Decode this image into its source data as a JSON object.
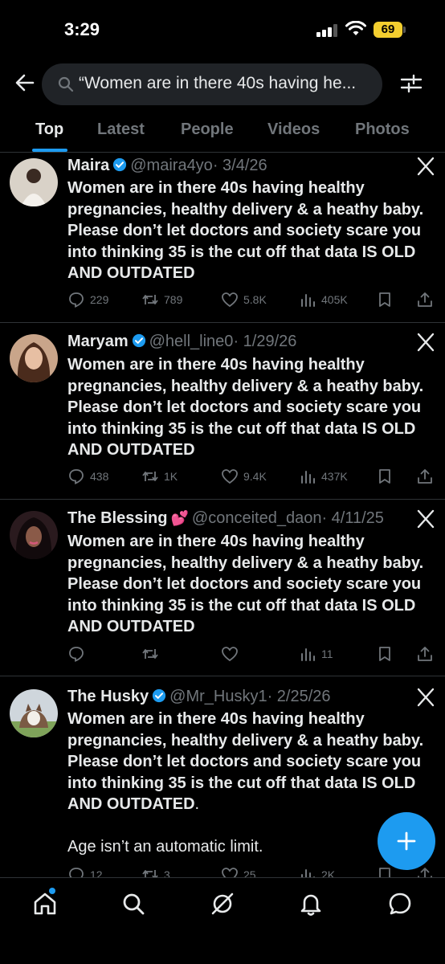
{
  "status_bar": {
    "time": "3:29",
    "battery": "69"
  },
  "search": {
    "query": "“Women are in there 40s having he..."
  },
  "tabs": [
    {
      "label": "Top",
      "active": true
    },
    {
      "label": "Latest"
    },
    {
      "label": "People"
    },
    {
      "label": "Videos"
    },
    {
      "label": "Photos"
    }
  ],
  "posts": [
    {
      "name": "Maira",
      "verified": true,
      "handle": "@maira4yo",
      "date": "· 3/4/26",
      "text": "Women are in there 40s having healthy pregnancies, healthy delivery & a heathy baby. Please don’t let doctors and society scare you into thinking 35 is the cut off that data IS OLD AND OUTDATED",
      "replies": "229",
      "reposts": "789",
      "likes": "5.8K",
      "views": "405K"
    },
    {
      "name": "Maryam",
      "verified": true,
      "handle": "@hell_line0",
      "date": "· 1/29/26",
      "text": "Women are in there 40s having healthy pregnancies, healthy delivery & a heathy baby. Please don’t let doctors and society scare you into thinking 35 is the cut off that data IS OLD AND OUTDATED",
      "replies": "438",
      "reposts": "1K",
      "likes": "9.4K",
      "views": "437K"
    },
    {
      "name": "The Blessing",
      "emoji": "💕",
      "handle": "@conceited_daon",
      "date": "· 4/11/25",
      "text": "Women are in there 40s having healthy pregnancies, healthy delivery & a heathy baby. Please don’t let doctors and society scare you into thinking 35 is the cut off that data IS OLD AND OUTDATED",
      "replies": "",
      "reposts": "",
      "likes": "",
      "views": "11"
    },
    {
      "name": "The Husky",
      "verified": true,
      "handle": "@Mr_Husky1",
      "date": "· 2/25/26",
      "text": "Women are in there 40s having healthy pregnancies, healthy delivery & a heathy baby. Please don’t let doctors and society scare you into thinking 35 is the cut off that data IS OLD AND OUTDATED",
      "text_suffix": ".",
      "text_extra": "Age isn’t an automatic limit.",
      "replies": "12",
      "reposts": "3",
      "likes": "25",
      "views": "2K"
    }
  ],
  "colors": {
    "accent": "#1d9bf0",
    "muted": "#71767b",
    "divider": "#2f3336",
    "battery": "#f4cf2f"
  }
}
